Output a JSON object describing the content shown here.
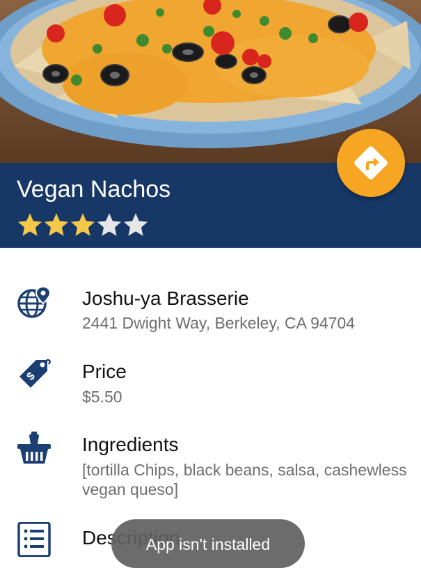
{
  "dish": {
    "title": "Vegan Nachos",
    "rating": {
      "value": 3,
      "max": 5
    }
  },
  "colors": {
    "header_band": "#173866",
    "fab": "#f6a623",
    "star_filled": "#f5c84a",
    "star_empty": "#e6e6e6",
    "icon": "#1b3f73",
    "secondary_text": "#6e6e6e"
  },
  "icons": {
    "directions": "directions-icon",
    "location": "globe-location-icon",
    "price": "price-tag-icon",
    "ingredients": "basket-icon",
    "description": "list-icon"
  },
  "details": {
    "restaurant": {
      "name": "Joshu-ya Brasserie",
      "address": "2441 Dwight Way, Berkeley, CA 94704"
    },
    "price": {
      "label": "Price",
      "value": "$5.50"
    },
    "ingredients": {
      "label": "Ingredients",
      "value": "[tortilla Chips, black beans, salsa, cashewless vegan queso]"
    },
    "description": {
      "label": "Description"
    }
  },
  "toast": {
    "text": "App isn't installed"
  }
}
